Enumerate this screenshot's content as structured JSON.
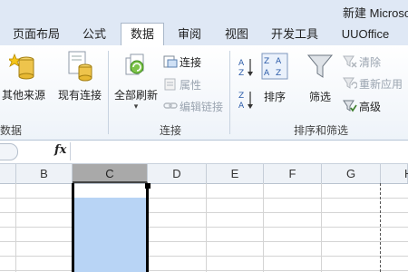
{
  "window": {
    "title": "新建 Microso"
  },
  "tabs": [
    {
      "label": "页面布局"
    },
    {
      "label": "公式"
    },
    {
      "label": "数据",
      "active": true
    },
    {
      "label": "审阅"
    },
    {
      "label": "视图"
    },
    {
      "label": "开发工具"
    },
    {
      "label": "UUOffice"
    }
  ],
  "ribbon": {
    "get_external": {
      "other_sources": "其他来源",
      "existing_connections": "现有连接",
      "group_label": "数据"
    },
    "connections": {
      "refresh_all": "全部刷新",
      "connections": "连接",
      "properties": "属性",
      "edit_links": "编辑链接",
      "group_label": "连接"
    },
    "sort_filter": {
      "sort": "排序",
      "filter": "筛选",
      "clear": "清除",
      "reapply": "重新应用",
      "advanced": "高级",
      "group_label": "排序和筛选"
    }
  },
  "formula_bar": {
    "fx_label": "fx",
    "value": ""
  },
  "columns": [
    "B",
    "C",
    "D",
    "E",
    "F",
    "G",
    "H"
  ],
  "selected_column": "C",
  "colors": {
    "accent": "#dfe8f5",
    "selection": "#b8d4f5",
    "selected_header": "#a9a9a9"
  }
}
